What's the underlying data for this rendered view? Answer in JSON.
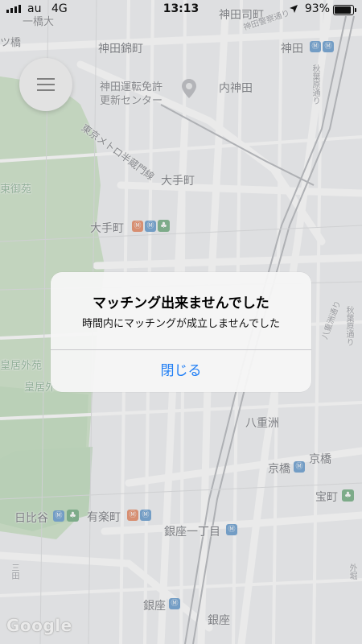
{
  "status_bar": {
    "carrier": "au",
    "network": "4G",
    "time": "13:13",
    "battery": "93%"
  },
  "map": {
    "labels": {
      "hitotsubashi": "一橋大",
      "tsubashi_left": "ツ橋",
      "kanda_nishikicho": "神田錦町",
      "kanda_tsukasamachi": "神田司町",
      "kanda_keisatsu_dori": "神田警察通り",
      "kanda": "神田",
      "license_center_1": "神田運転免許",
      "license_center_2": "更新センター",
      "uchikanda": "内神田",
      "route_hanzomon": "東京メトロ半蔵門線",
      "otemachi": "大手町",
      "otemachi_station": "大手町",
      "higashi_gyoen": "東御苑",
      "kokyo_gaien": "皇居外苑",
      "kokyo": "皇居外",
      "yaesu": "八重洲",
      "kyobashi_station": "京橋",
      "kyobashi": "京橋",
      "takaracho": "宝町",
      "hibiya": "日比谷",
      "yurakucho": "有楽町",
      "ginza_itchome": "銀座一丁目",
      "ginza_station": "銀座",
      "ginza": "銀座",
      "akihabara_dori": "秋葉原通り",
      "yaesu_dori": "八重洲通り",
      "sotobori": "外堀",
      "mita": "三田"
    },
    "logo": "Google"
  },
  "alert": {
    "title": "マッチング出来ませんでした",
    "message": "時間内にマッチングが成立しませんでした",
    "button": "閉じる"
  },
  "colors": {
    "accent": "#1f7ef5",
    "park": "#b7d8b2",
    "metro": "#3f83c3"
  },
  "icons": [
    "menu-icon",
    "signal-icon",
    "location-arrow-icon",
    "battery-icon",
    "metro-station-icon",
    "park-icon",
    "map-pin-icon"
  ]
}
